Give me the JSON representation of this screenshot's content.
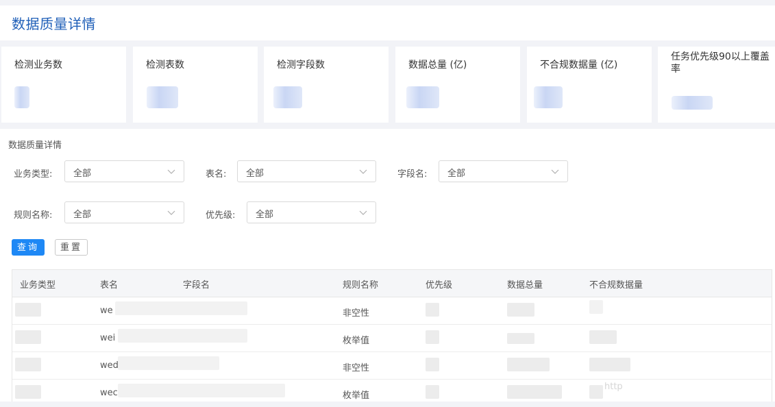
{
  "header": {
    "title": "数据质量详情"
  },
  "cards": [
    {
      "label": "检测业务数"
    },
    {
      "label": "检测表数"
    },
    {
      "label": "检测字段数"
    },
    {
      "label": "数据总量 (亿)"
    },
    {
      "label": "不合规数据量 (亿)"
    },
    {
      "label": "任务优先级90以上覆盖率"
    }
  ],
  "panel": {
    "title": "数据质量详情",
    "filters": {
      "business_type": {
        "label": "业务类型:",
        "value": "全部"
      },
      "table_name": {
        "label": "表名:",
        "value": "全部"
      },
      "field_name": {
        "label": "字段名:",
        "value": "全部"
      },
      "rule_name": {
        "label": "规则名称:",
        "value": "全部"
      },
      "priority": {
        "label": "优先级:",
        "value": "全部"
      }
    },
    "buttons": {
      "query": "查询",
      "reset": "重置"
    }
  },
  "table": {
    "columns": [
      "业务类型",
      "表名",
      "字段名",
      "规则名称",
      "优先级",
      "数据总量",
      "不合规数据量"
    ],
    "rows": [
      {
        "table_prefix": "we",
        "rule": "非空性"
      },
      {
        "table_prefix": "wei",
        "rule": "枚举值"
      },
      {
        "table_prefix": "wed",
        "rule": "非空性"
      },
      {
        "table_prefix": "wec",
        "rule": "枚举值"
      }
    ]
  },
  "watermark": "http"
}
